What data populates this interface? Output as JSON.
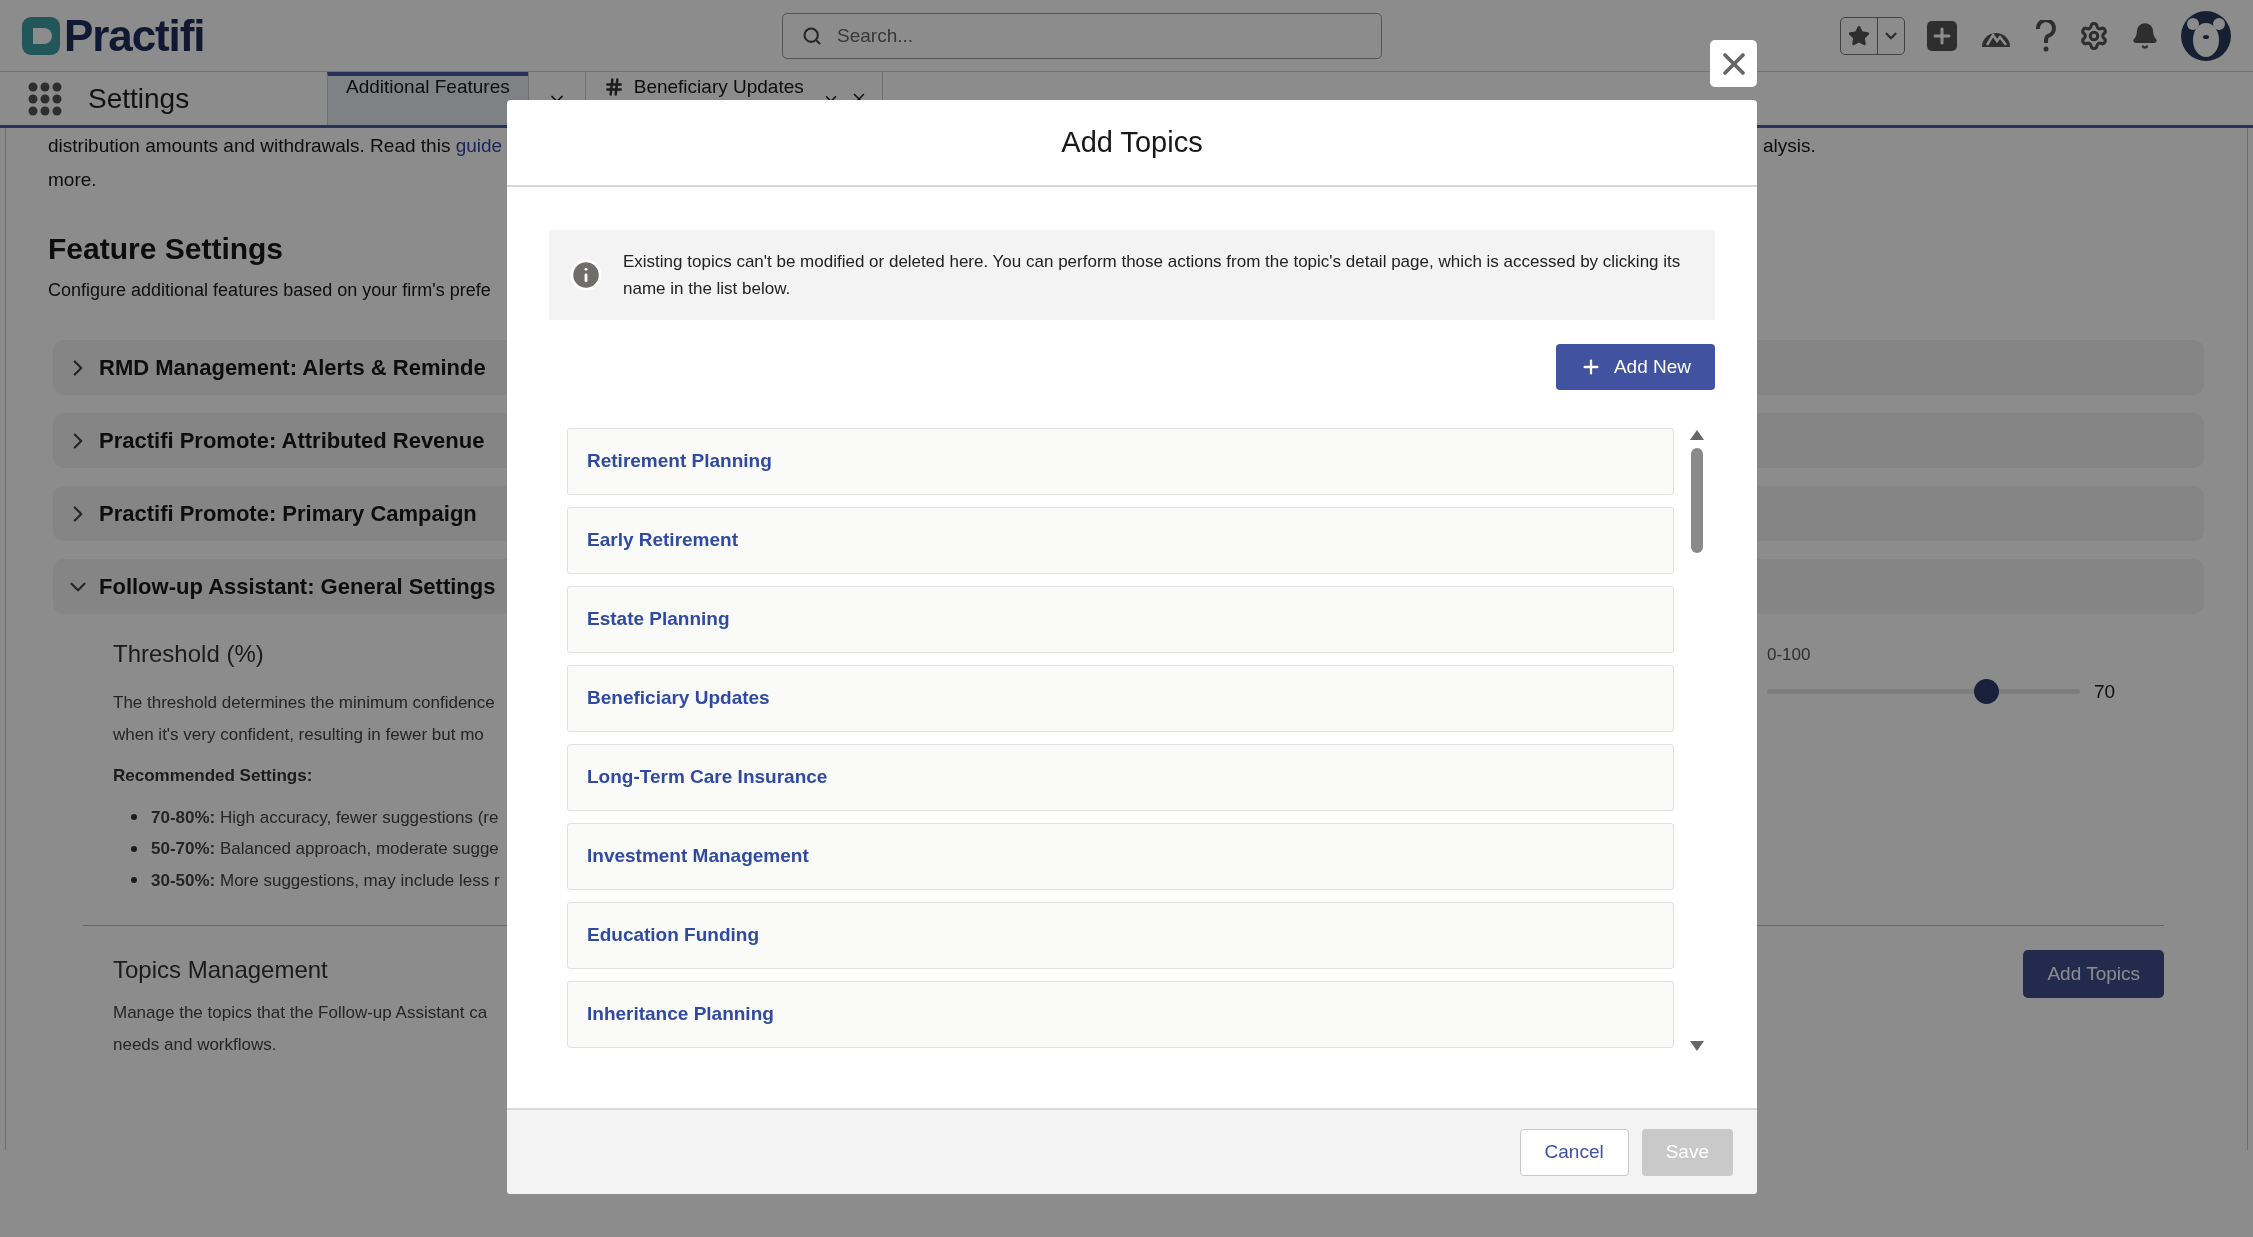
{
  "header": {
    "logo": "Practifi",
    "search": {
      "placeholder": "Search..."
    }
  },
  "nav": {
    "app_name": "Settings",
    "tabs": [
      {
        "label": "Additional Features",
        "selected": true,
        "kind": "plain"
      },
      {
        "label": "Beneficiary Updates",
        "selected": false,
        "kind": "record"
      }
    ]
  },
  "page": {
    "intro": {
      "text": "distribution amounts and withdrawals. Read this",
      "link": "guide",
      "tail": "alysis.",
      "line2": "more."
    },
    "title": "Feature Settings",
    "subtitle": "Configure additional features based on your firm's prefe",
    "sections": [
      {
        "title": "RMD Management: Alerts & Reminde",
        "expanded": false
      },
      {
        "title": "Practifi Promote: Attributed Revenue",
        "expanded": false
      },
      {
        "title": "Practifi Promote: Primary Campaign",
        "expanded": false
      },
      {
        "title": "Follow-up Assistant: General Settings",
        "expanded": true
      }
    ],
    "threshold": {
      "title": "Threshold (%)",
      "lines": [
        "The threshold determines the minimum confidence",
        "when it's very confident, resulting in fewer but mo"
      ],
      "recommended": "Recommended Settings:",
      "bullets": [
        "**70-80%:** High accuracy, fewer suggestions (re",
        "**50-70%:** Balanced approach, moderate sugge",
        "**30-50%:** More suggestions, may include less r"
      ],
      "range_label": "0-100",
      "level": 0.7,
      "value": "70"
    },
    "topics": {
      "title": "Topics Management",
      "lines": [
        "Manage the topics that the Follow-up Assistant ca",
        "needs and workflows."
      ],
      "button": "Add Topics"
    }
  },
  "modal": {
    "title": "Add Topics",
    "info": "Existing topics can't be modified or deleted here. You can perform those actions from the topic's detail page, which is accessed by clicking its name in the list below.",
    "add_button": "Add New",
    "topics": [
      "Retirement Planning",
      "Early Retirement",
      "Estate Planning",
      "Beneficiary Updates",
      "Long-Term Care Insurance",
      "Investment Management",
      "Education Funding",
      "Inheritance Planning"
    ],
    "cancel": {
      "label": "Cancel",
      "disabled": false
    },
    "save": {
      "label": "Save",
      "disabled": true
    }
  }
}
